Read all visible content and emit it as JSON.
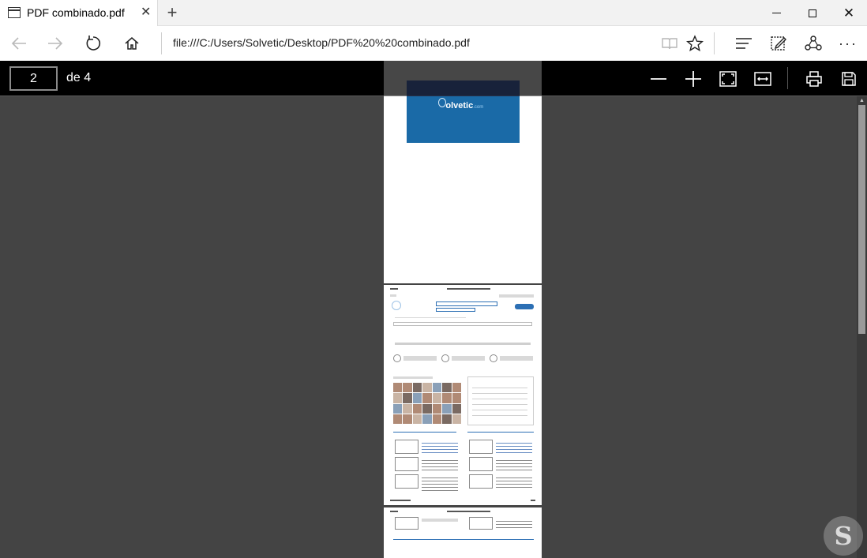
{
  "browser": {
    "tab": {
      "title": "PDF combinado.pdf",
      "icon": "page-icon",
      "close_label": "✕"
    },
    "new_tab_label": "+",
    "address": "file:///C:/Users/Solvetic/Desktop/PDF%20%20combinado.pdf",
    "window_controls": {
      "minimize": "minimize-icon",
      "maximize": "maximize-icon",
      "close": "✕"
    },
    "more_label": "···"
  },
  "pdf_toolbar": {
    "current_page": "2",
    "page_total_label": "de 4"
  },
  "document": {
    "cover_logo": "olvetic",
    "cover_logo_prefix": "S",
    "cover_logo_suffix": ".com"
  },
  "scrollbar": {
    "up_arrow": "▲"
  },
  "watermark": {
    "letter": "S"
  }
}
